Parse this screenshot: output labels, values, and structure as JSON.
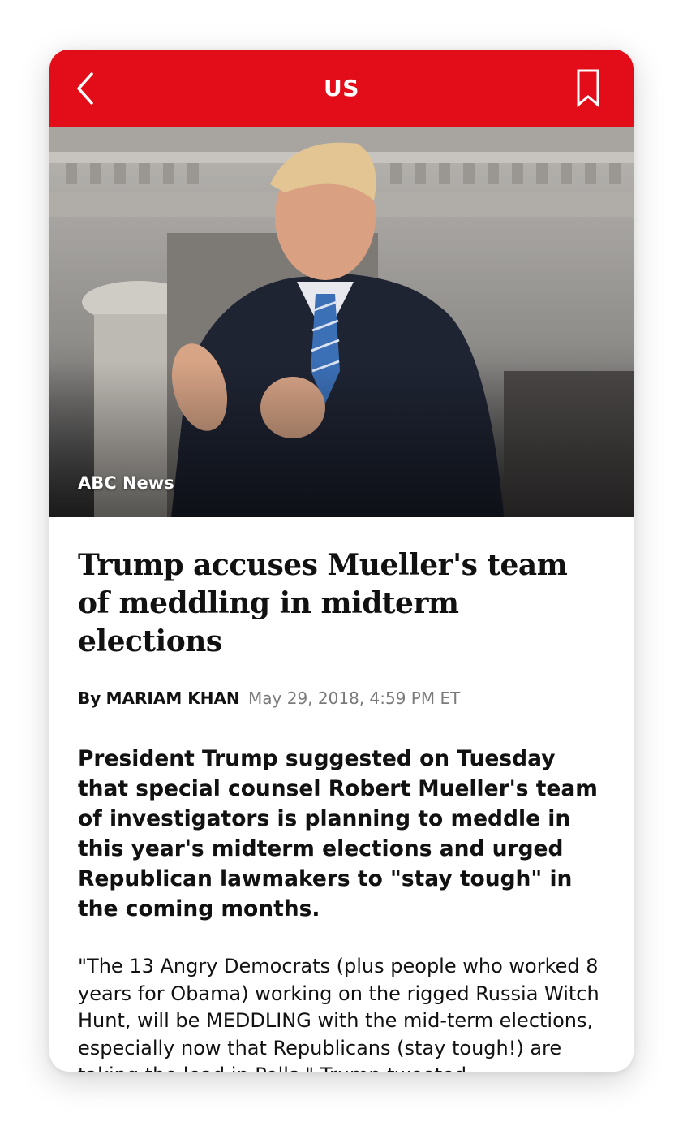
{
  "header": {
    "section_title": "US",
    "back_icon": "chevron-left-icon",
    "bookmark_icon": "bookmark-icon",
    "bar_color": "#e20d18"
  },
  "hero": {
    "credit": "ABC News"
  },
  "article": {
    "headline": "Trump accuses Mueller's team of meddling in midterm elections",
    "byline_prefix": "By",
    "author": "MARIAM KHAN",
    "timestamp": "May 29, 2018, 4:59 PM ET",
    "lede": "President Trump suggested on Tuesday that special counsel Robert Mueller's team of investigators is planning to meddle in this year's midterm elections and urged Republican lawmakers to \"stay tough\" in the coming months.",
    "body_paragraph": "\"The 13 Angry Democrats (plus people who worked 8 years for Obama) working on the rigged Russia Witch Hunt, will be MEDDLING with the mid-term elections, especially now that Republicans (stay tough!) are taking the lead in Polls,\" Trump tweeted."
  }
}
